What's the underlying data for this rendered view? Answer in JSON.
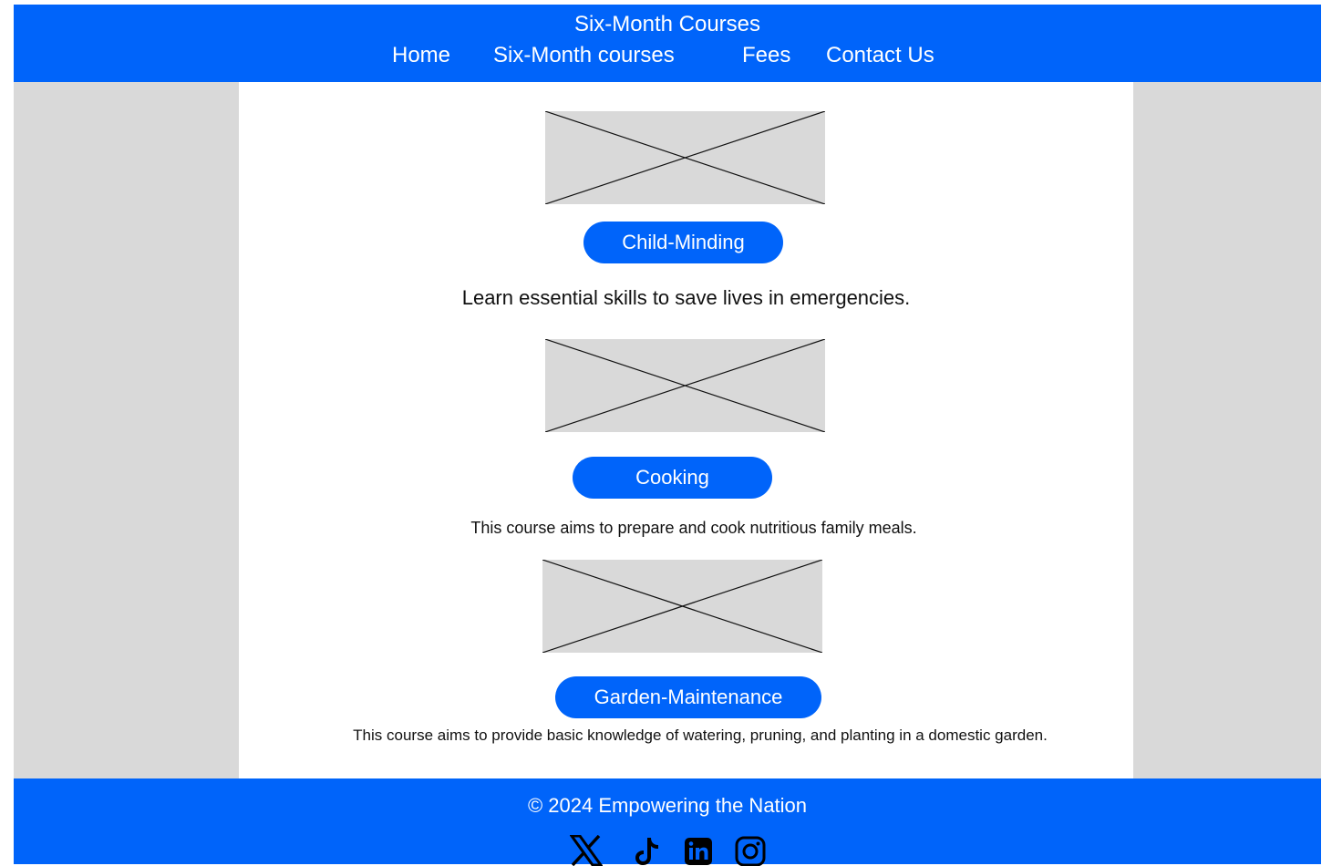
{
  "header": {
    "title": "Six-Month Courses",
    "nav": [
      {
        "label": "Home"
      },
      {
        "label": "Six-Month courses"
      },
      {
        "label": "Fees"
      },
      {
        "label": "Contact Us"
      }
    ]
  },
  "courses": [
    {
      "name": "Child-Minding",
      "description": "Learn essential skills to save lives in emergencies."
    },
    {
      "name": "Cooking",
      "description": "This course aims to prepare and cook nutritious family meals."
    },
    {
      "name": "Garden-Maintenance",
      "description": "This course aims to provide basic knowledge of watering, pruning, and planting in a domestic garden."
    }
  ],
  "footer": {
    "copyright": "© 2024 Empowering the Nation",
    "social": [
      {
        "icon": "x-twitter-icon"
      },
      {
        "icon": "tiktok-icon"
      },
      {
        "icon": "linkedin-icon"
      },
      {
        "icon": "instagram-icon"
      }
    ]
  },
  "colors": {
    "brand_blue": "#0064fa",
    "page_gray": "#d9d9d9",
    "content_white": "#ffffff"
  }
}
